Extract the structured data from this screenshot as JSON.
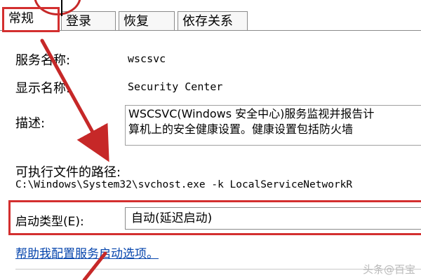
{
  "tabs": [
    {
      "label": "常规",
      "active": true
    },
    {
      "label": "登录",
      "active": false
    },
    {
      "label": "恢复",
      "active": false
    },
    {
      "label": "依存关系",
      "active": false
    }
  ],
  "service_name": {
    "label": "服务名称:",
    "value": "wscsvc"
  },
  "display_name": {
    "label": "显示名称:",
    "value": "Security Center"
  },
  "description": {
    "label": "描述:",
    "lines": [
      "WSCSVC(Windows 安全中心)服务监视并报告计",
      "算机上的安全健康设置。健康设置包括防火墙"
    ]
  },
  "exec_path": {
    "label": "可执行文件的路径:",
    "value": "C:\\Windows\\System32\\svchost.exe -k LocalServiceNetworkR"
  },
  "startup_type": {
    "label": "启动类型(E):",
    "value": "自动(延迟启动)"
  },
  "help_link": "帮助我配置服务启动选项。",
  "watermark": "头条@百宝",
  "colors": {
    "annotation": "#d32f2f",
    "link": "#0645ad"
  }
}
